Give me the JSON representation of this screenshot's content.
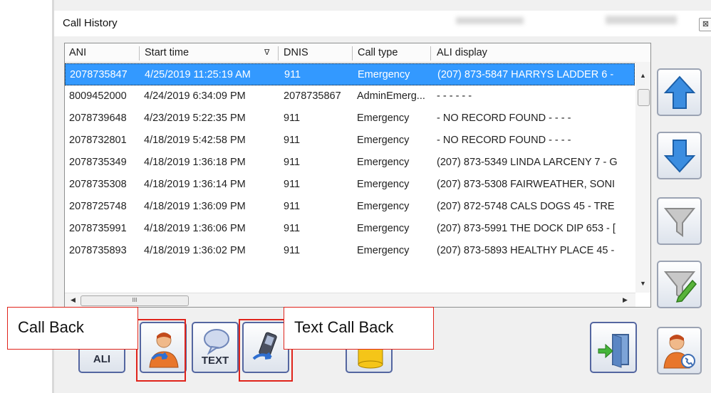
{
  "window": {
    "title": "Call History",
    "close_glyph": "⊠"
  },
  "grid": {
    "columns": [
      "ANI",
      "Start time",
      "DNIS",
      "Call type",
      "ALI display"
    ],
    "sort_indicator": "∇",
    "rows": [
      {
        "ani": "2078735847",
        "start": "4/25/2019 11:25:19 AM",
        "dnis": "911",
        "type": "Emergency",
        "ali": "(207) 873-5847 HARRYS LADDER 6 -",
        "selected": true
      },
      {
        "ani": "8009452000",
        "start": "4/24/2019 6:34:09 PM",
        "dnis": "2078735867",
        "type": "AdminEmerg...",
        "ali": "- - - - - -"
      },
      {
        "ani": "2078739648",
        "start": "4/23/2019 5:22:35 PM",
        "dnis": "911",
        "type": "Emergency",
        "ali": "- NO RECORD FOUND - - - -"
      },
      {
        "ani": "2078732801",
        "start": "4/18/2019 5:42:58 PM",
        "dnis": "911",
        "type": "Emergency",
        "ali": "- NO RECORD FOUND - - - -"
      },
      {
        "ani": "2078735349",
        "start": "4/18/2019 1:36:18 PM",
        "dnis": "911",
        "type": "Emergency",
        "ali": "(207) 873-5349 LINDA LARCENY 7 - G"
      },
      {
        "ani": "2078735308",
        "start": "4/18/2019 1:36:14 PM",
        "dnis": "911",
        "type": "Emergency",
        "ali": "(207) 873-5308 FAIRWEATHER, SONI"
      },
      {
        "ani": "2078725748",
        "start": "4/18/2019 1:36:09 PM",
        "dnis": "911",
        "type": "Emergency",
        "ali": "(207) 872-5748 CALS DOGS 45 - TRE"
      },
      {
        "ani": "2078735991",
        "start": "4/18/2019 1:36:06 PM",
        "dnis": "911",
        "type": "Emergency",
        "ali": "(207) 873-5991 THE DOCK DIP 653 - ["
      },
      {
        "ani": "2078735893",
        "start": "4/18/2019 1:36:02 PM",
        "dnis": "911",
        "type": "Emergency",
        "ali": "(207) 873-5893 HEALTHY PLACE 45 -"
      }
    ],
    "hscroll_grip": "III"
  },
  "side_buttons": [
    "arrow-up-icon",
    "arrow-down-icon",
    "filter-icon",
    "edit-filter-icon",
    "contact-phone-icon"
  ],
  "bottom_buttons": {
    "ali_label": "ALI",
    "text_label": "TEXT"
  },
  "annotations": {
    "call_back": "Call Back",
    "text_call_back": "Text Call Back",
    "highlight_color": "#e0241b"
  },
  "colors": {
    "selection": "#3399ff",
    "button_border": "#5466a0"
  }
}
